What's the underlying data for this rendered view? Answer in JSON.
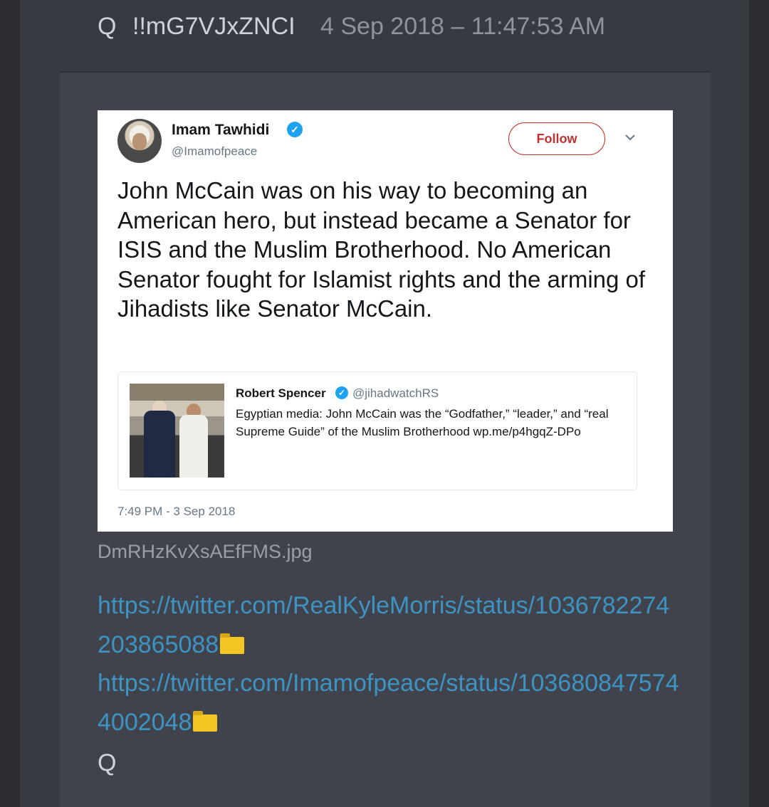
{
  "post": {
    "name": "Q",
    "tripcode": "!!mG7VJxZNCI",
    "date": "4 Sep 2018 – 11:47:53 AM",
    "filename": "DmRHzKvXsAEfFMS.jpg",
    "links": [
      "https://twitter.com/RealKyleMorris/status/1036782274203865088",
      "https://twitter.com/Imamofpeace/status/1036808475744002048"
    ],
    "signature": "Q"
  },
  "tweet": {
    "author_name": "Imam Tawhidi",
    "author_handle": "@Imamofpeace",
    "follow_label": "Follow",
    "text": "John McCain was on his way to becoming an American hero, but instead became a Senator for ISIS and the Muslim Brotherhood. No American Senator fought for Islamist rights and the arming of Jihadists like Senator McCain.",
    "timestamp": "7:49 PM - 3 Sep 2018",
    "quote": {
      "author_name": "Robert Spencer",
      "author_handle": "@jihadwatchRS",
      "text": "Egyptian media: John McCain was the “Godfather,” “leader,” and “real Supreme Guide” of the Muslim Brotherhood wp.me/p4hgqZ-DPo"
    }
  },
  "icons": {
    "verified": "verified-check-icon",
    "chevron": "chevron-down-icon",
    "folder": "folder-icon"
  },
  "colors": {
    "link": "#3d93c2",
    "follow": "#c0322f",
    "verified": "#1da1f2"
  }
}
